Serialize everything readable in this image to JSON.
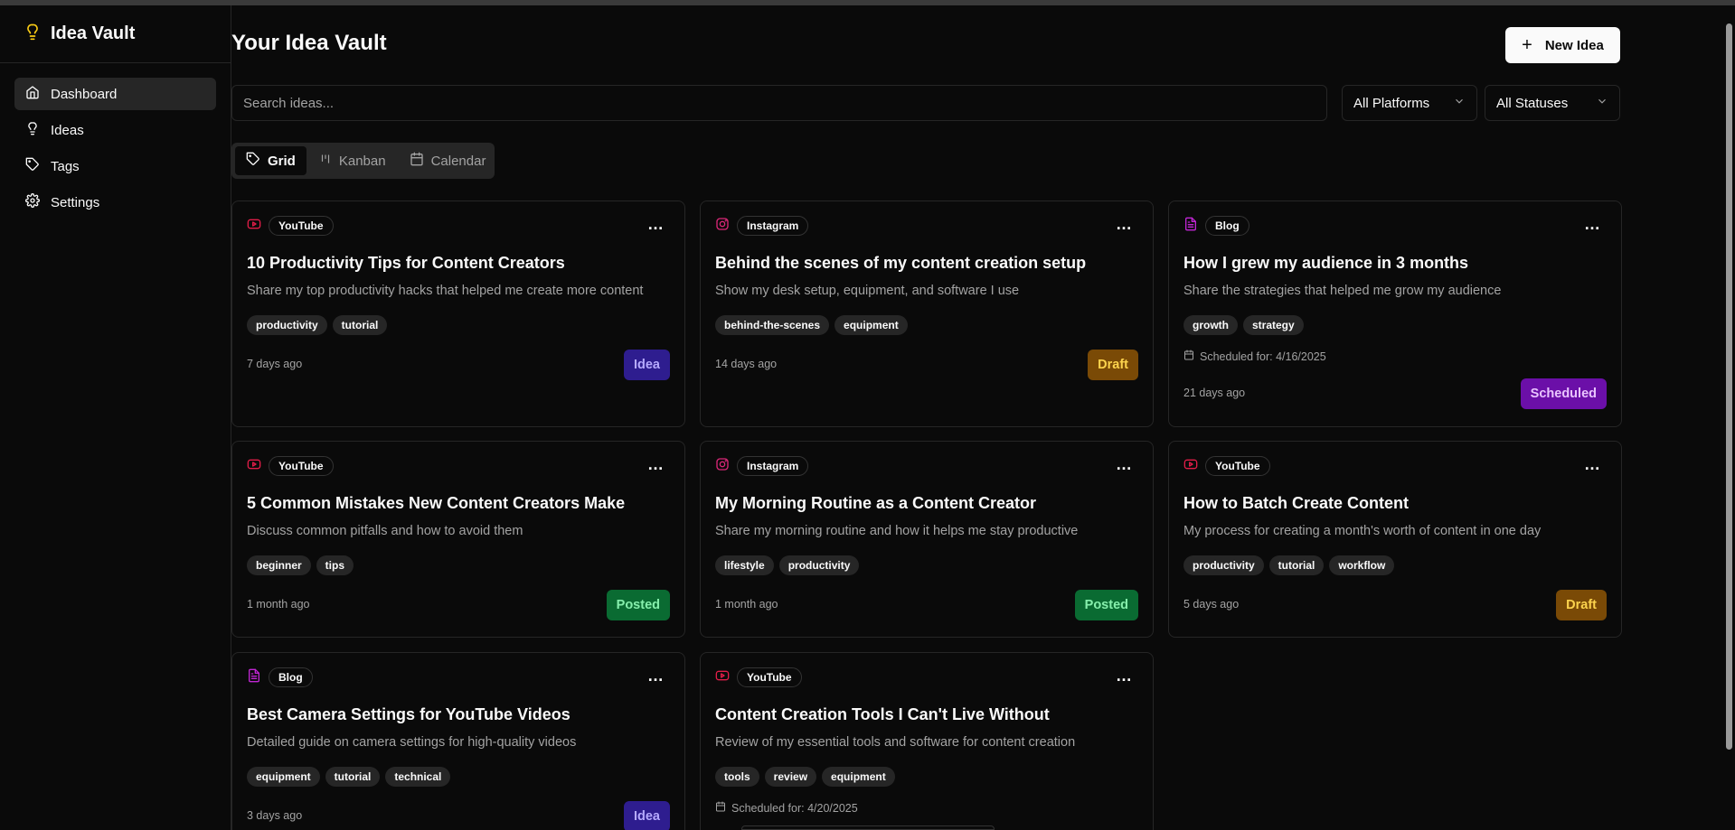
{
  "app": {
    "name": "Idea Vault"
  },
  "sidebar": {
    "items": [
      {
        "label": "Dashboard",
        "icon": "home-icon",
        "active": true
      },
      {
        "label": "Ideas",
        "icon": "lightbulb-icon",
        "active": false
      },
      {
        "label": "Tags",
        "icon": "tag-icon",
        "active": false
      },
      {
        "label": "Settings",
        "icon": "gear-icon",
        "active": false
      }
    ]
  },
  "header": {
    "title": "Your Idea Vault",
    "new_button": "New Idea"
  },
  "filters": {
    "search_placeholder": "Search ideas...",
    "platform": "All Platforms",
    "status": "All Statuses"
  },
  "views": [
    {
      "label": "Grid",
      "icon": "tag-icon",
      "active": true
    },
    {
      "label": "Kanban",
      "icon": "kanban-icon",
      "active": false
    },
    {
      "label": "Calendar",
      "icon": "calendar-icon",
      "active": false
    }
  ],
  "cards": [
    {
      "platform": "YouTube",
      "title": "10 Productivity Tips for Content Creators",
      "description": "Share my top productivity hacks that helped me create more content",
      "tags": [
        "productivity",
        "tutorial"
      ],
      "scheduled": "",
      "age": "7 days ago",
      "status": "Idea"
    },
    {
      "platform": "Instagram",
      "title": "Behind the scenes of my content creation setup",
      "description": "Show my desk setup, equipment, and software I use",
      "tags": [
        "behind-the-scenes",
        "equipment"
      ],
      "scheduled": "",
      "age": "14 days ago",
      "status": "Draft"
    },
    {
      "platform": "Blog",
      "title": "How I grew my audience in 3 months",
      "description": "Share the strategies that helped me grow my audience",
      "tags": [
        "growth",
        "strategy"
      ],
      "scheduled": "Scheduled for: 4/16/2025",
      "age": "21 days ago",
      "status": "Scheduled"
    },
    {
      "platform": "YouTube",
      "title": "5 Common Mistakes New Content Creators Make",
      "description": "Discuss common pitfalls and how to avoid them",
      "tags": [
        "beginner",
        "tips"
      ],
      "scheduled": "",
      "age": "1 month ago",
      "status": "Posted"
    },
    {
      "platform": "Instagram",
      "title": "My Morning Routine as a Content Creator",
      "description": "Share my morning routine and how it helps me stay productive",
      "tags": [
        "lifestyle",
        "productivity"
      ],
      "scheduled": "",
      "age": "1 month ago",
      "status": "Posted"
    },
    {
      "platform": "YouTube",
      "title": "How to Batch Create Content",
      "description": "My process for creating a month's worth of content in one day",
      "tags": [
        "productivity",
        "tutorial",
        "workflow"
      ],
      "scheduled": "",
      "age": "5 days ago",
      "status": "Draft"
    },
    {
      "platform": "Blog",
      "title": "Best Camera Settings for YouTube Videos",
      "description": "Detailed guide on camera settings for high-quality videos",
      "tags": [
        "equipment",
        "tutorial",
        "technical"
      ],
      "scheduled": "",
      "age": "3 days ago",
      "status": "Idea"
    },
    {
      "platform": "YouTube",
      "title": "Content Creation Tools I Can't Live Without",
      "description": "Review of my essential tools and software for content creation",
      "tags": [
        "tools",
        "review",
        "equipment"
      ],
      "scheduled": "Scheduled for: 4/20/2025",
      "age": "",
      "status": ""
    }
  ],
  "colors": {
    "background": "#0a0a0a",
    "youtube": "#e11d48",
    "instagram": "#db2777",
    "blog": "#c026d3",
    "brand_icon": "#facc15"
  }
}
